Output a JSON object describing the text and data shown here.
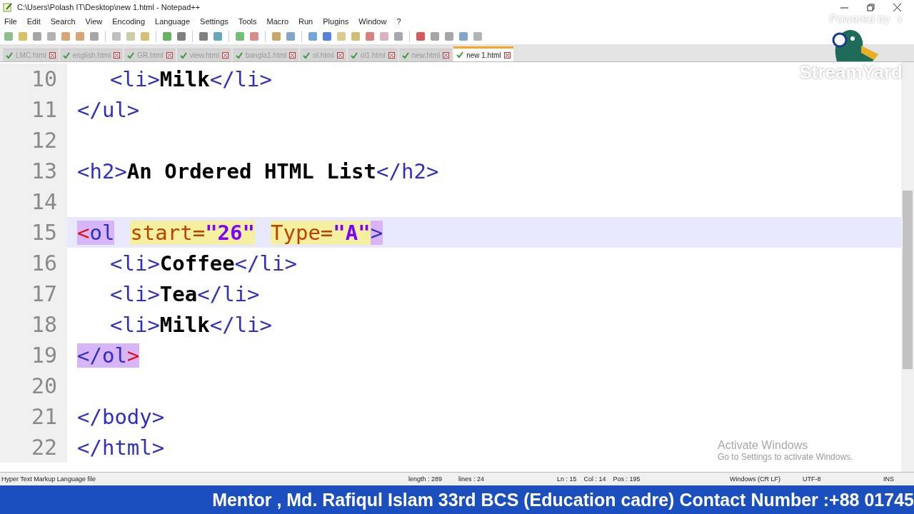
{
  "window": {
    "title": "C:\\Users\\Polash IT\\Desktop\\new 1.html - Notepad++"
  },
  "menu": [
    "File",
    "Edit",
    "Search",
    "View",
    "Encoding",
    "Language",
    "Settings",
    "Tools",
    "Macro",
    "Run",
    "Plugins",
    "Window",
    "?"
  ],
  "tabs": [
    {
      "label": "LMC.html",
      "selected": false
    },
    {
      "label": "english.html",
      "selected": false
    },
    {
      "label": "GR.html",
      "selected": false
    },
    {
      "label": "view.html",
      "selected": false
    },
    {
      "label": "bangla1.html",
      "selected": false
    },
    {
      "label": "ol.html",
      "selected": false
    },
    {
      "label": "ol1.html",
      "selected": false
    },
    {
      "label": "new.html",
      "selected": false
    },
    {
      "label": "new 1.html",
      "selected": true
    }
  ],
  "lines": [
    {
      "number": "10",
      "current": false,
      "indented": true,
      "tokens": [
        {
          "kind": "tag",
          "text": "<li>"
        },
        {
          "kind": "text",
          "text": "Milk"
        },
        {
          "kind": "tag",
          "text": "</li>"
        }
      ]
    },
    {
      "number": "11",
      "current": false,
      "indented": false,
      "tokens": [
        {
          "kind": "tag",
          "text": "</ul>"
        }
      ]
    },
    {
      "number": "12",
      "current": false
    },
    {
      "number": "13",
      "current": false,
      "indented": false,
      "tokens": [
        {
          "kind": "tag",
          "text": "<h2>"
        },
        {
          "kind": "text",
          "text": "An Ordered HTML List"
        },
        {
          "kind": "tag",
          "text": "</h2>"
        }
      ]
    },
    {
      "number": "14",
      "current": false
    },
    {
      "number": "15",
      "current": true,
      "indented": false,
      "tokens": [
        {
          "kind": "brace",
          "text": "<",
          "highlighted": true
        },
        {
          "kind": "tag",
          "text": "ol",
          "highlighted": true
        },
        {
          "kind": "attr",
          "text": "start=",
          "highlighted": true,
          "space_before": true
        },
        {
          "kind": "value",
          "text": "\"26\"",
          "highlighted": true
        },
        {
          "kind": "attr",
          "text": "Type=",
          "highlighted": true,
          "space_before": true
        },
        {
          "kind": "value",
          "text": "\"A\"",
          "highlighted": true
        },
        {
          "kind": "tag",
          "text": ">",
          "highlighted": true
        }
      ]
    },
    {
      "number": "16",
      "current": false,
      "indented": true,
      "tokens": [
        {
          "kind": "tag",
          "text": "<li>"
        },
        {
          "kind": "text",
          "text": "Coffee"
        },
        {
          "kind": "tag",
          "text": "</li>"
        }
      ]
    },
    {
      "number": "17",
      "current": false,
      "indented": true,
      "tokens": [
        {
          "kind": "tag",
          "text": "<li>"
        },
        {
          "kind": "text",
          "text": "Tea"
        },
        {
          "kind": "tag",
          "text": "</li>"
        }
      ]
    },
    {
      "number": "18",
      "current": false,
      "indented": true,
      "tokens": [
        {
          "kind": "tag",
          "text": "<li>"
        },
        {
          "kind": "text",
          "text": "Milk"
        },
        {
          "kind": "tag",
          "text": "</li>"
        }
      ]
    },
    {
      "number": "19",
      "current": false,
      "indented": false,
      "tokens": [
        {
          "kind": "tag",
          "text": "</ol",
          "highlighted": true
        },
        {
          "kind": "brace",
          "text": ">",
          "highlighted": true
        }
      ]
    },
    {
      "number": "20",
      "current": false
    },
    {
      "number": "21",
      "current": false,
      "indented": false,
      "tokens": [
        {
          "kind": "tag",
          "text": "</body>"
        }
      ]
    },
    {
      "number": "22",
      "current": false,
      "indented": false,
      "tokens": [
        {
          "kind": "tag",
          "text": "</html>"
        }
      ]
    }
  ],
  "overlay": {
    "powered_by": "Powered by",
    "brand": "StreamYard",
    "close": "x"
  },
  "activation": {
    "title": "Activate Windows",
    "subtitle": "Go to Settings to activate Windows."
  },
  "status_bar": {
    "file_type": "Hyper Text Markup Language file",
    "length": "length : 289",
    "lines": "lines : 24",
    "position": "Ln : 15    Col : 14    Pos : 195",
    "eol": "Windows (CR LF)",
    "encoding": "UTF-8",
    "mode": "INS"
  },
  "banner": "Mentor , Md. Rafiqul Islam 33rd BCS (Education cadre) Contact Number :+88 01745"
}
